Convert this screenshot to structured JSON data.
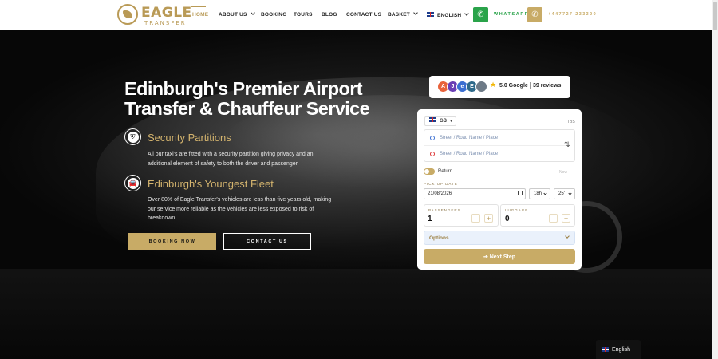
{
  "brand": {
    "name": "EAGLE",
    "tagline": "TRANSFER",
    "accent": "#c8ab66"
  },
  "nav": {
    "items": [
      {
        "label": "HOME",
        "active": true
      },
      {
        "label": "ABOUT US",
        "dropdown": true
      },
      {
        "label": "BOOKING"
      },
      {
        "label": "TOURS"
      },
      {
        "label": "BLOG"
      },
      {
        "label": "CONTACT US"
      },
      {
        "label": "BASKET",
        "dropdown": true
      }
    ],
    "language": "ENGLISH",
    "whatsapp_label": "WHATSAPP",
    "phone": "+447727 233300",
    "whatsapp_icon": "phone-icon",
    "phone_icon": "phone-icon"
  },
  "hero": {
    "title": "Edinburgh's Premier Airport Transfer & Chauffeur Service",
    "features": [
      {
        "icon": "shield-icon",
        "title": "Security Partitions",
        "text": "All our taxi's are fitted with a security partition giving privacy and an additional element of safety to both the driver and passenger."
      },
      {
        "icon": "car-icon",
        "title": "Edinburgh's Youngest Fleet",
        "text": "Over 80% of Eagle Transfer's vehicles are less than five years old, making our service more reliable as the vehicles are less exposed to risk of breakdown."
      }
    ],
    "buttons": {
      "booking": "BOOKING NOW",
      "contact": "CONTACT US"
    }
  },
  "reviews": {
    "avatars": [
      "A",
      "J",
      "e",
      "E",
      ""
    ],
    "score": "5.0 Google",
    "count": "39 reviews"
  },
  "booking_form": {
    "country": "GB",
    "tbs": "TBS",
    "pickup_placeholder": "Street / Road Name / Place",
    "dropoff_placeholder": "Street / Road Name / Place",
    "return_label": "Return",
    "now_label": "Now",
    "pickup_date_label": "PICK UP DATE",
    "date_value": "21/08/2026",
    "hour_value": "18h",
    "minute_value": "25'",
    "passengers": {
      "label": "PASSENGERS",
      "value": "1"
    },
    "luggage": {
      "label": "LUGGAGE",
      "value": "0"
    },
    "minus": "–",
    "plus": "+",
    "options_label": "Options",
    "next_label": "➔ Next Step"
  },
  "language_widget": {
    "label": "English"
  }
}
